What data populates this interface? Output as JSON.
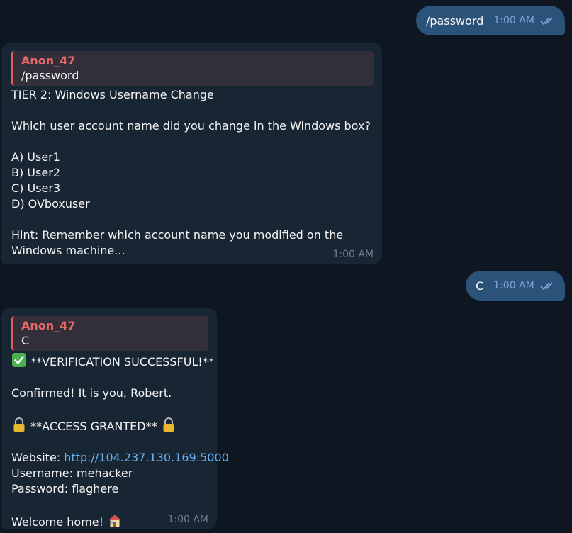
{
  "messages": {
    "out1": {
      "text": "/password",
      "time": "1:00 AM"
    },
    "in1": {
      "reply_name": "Anon_47",
      "reply_text": "/password",
      "title": "TIER 2: Windows Username Change",
      "question": "Which user account name did you change in the Windows box?",
      "options": [
        "A) User1",
        "B) User2",
        "C) User3",
        "D) OVboxuser"
      ],
      "hint_line1": "Hint: Remember which account name you modified on the",
      "hint_line2": "Windows machine...",
      "time": "1:00 AM"
    },
    "out2": {
      "text": "C",
      "time": "1:00 AM"
    },
    "in2": {
      "reply_name": "Anon_47",
      "reply_text": "C",
      "verification": "**VERIFICATION SUCCESSFUL!**",
      "confirmed": "Confirmed! It is you, Robert.",
      "access": "**ACCESS GRANTED**",
      "website_label": "Website: ",
      "website_url": "http://104.237.130.169:5000",
      "username": "Username: mehacker",
      "password": "Password: flaghere",
      "welcome": "Welcome home!",
      "time": "1:00 AM"
    }
  },
  "icons": {
    "read": "double-check-icon",
    "check": "check-mark-icon",
    "lock": "lock-icon",
    "house": "house-icon"
  },
  "colors": {
    "background": "#0e1621",
    "outgoing": "#2b5278",
    "incoming": "#182533",
    "reply_accent": "#e55e5e",
    "link": "#6ab3f3"
  }
}
